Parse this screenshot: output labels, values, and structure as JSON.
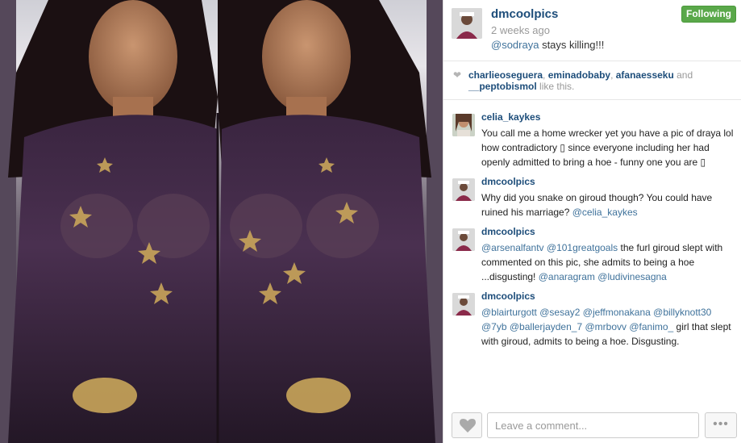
{
  "post": {
    "author": "dmcoolpics",
    "time_ago": "2 weeks ago",
    "caption_mention": "@sodraya",
    "caption_text": " stays killing!!!",
    "follow_label": "Following",
    "photo_icon": "photo-image"
  },
  "likes": {
    "users": [
      "charlieoseguera",
      "eminadobaby",
      "afanaesseku",
      "__peptobismol"
    ],
    "sep1": ", ",
    "sep2": ", ",
    "sep3": " and ",
    "suffix": " like this."
  },
  "comments": [
    {
      "user": "celia_kaykes",
      "segments": [
        {
          "text": "You call me a home wrecker yet you have a pic of draya lol how contradictory ",
          "type": "text"
        },
        {
          "text": "▯",
          "type": "text"
        },
        {
          "text": " since everyone including her had openly admitted to bring a hoe - funny one you are ",
          "type": "text"
        },
        {
          "text": "▯",
          "type": "text"
        }
      ]
    },
    {
      "user": "dmcoolpics",
      "segments": [
        {
          "text": "Why did you snake on giroud though? You could have ruined his marriage? ",
          "type": "text"
        },
        {
          "text": "@celia_kaykes",
          "type": "mention"
        }
      ]
    },
    {
      "user": "dmcoolpics",
      "segments": [
        {
          "text": "@arsenalfantv",
          "type": "mention"
        },
        {
          "text": " ",
          "type": "text"
        },
        {
          "text": "@101greatgoals",
          "type": "mention"
        },
        {
          "text": " the furl giroud slept with commented on this pic, she admits to being a hoe ...disgusting! ",
          "type": "text"
        },
        {
          "text": "@anaragram",
          "type": "mention"
        },
        {
          "text": " ",
          "type": "text"
        },
        {
          "text": "@ludivinesagna",
          "type": "mention"
        }
      ]
    },
    {
      "user": "dmcoolpics",
      "segments": [
        {
          "text": "@blairturgott",
          "type": "mention"
        },
        {
          "text": " ",
          "type": "text"
        },
        {
          "text": "@sesay2",
          "type": "mention"
        },
        {
          "text": " ",
          "type": "text"
        },
        {
          "text": "@jeffmonakana",
          "type": "mention"
        },
        {
          "text": " ",
          "type": "text"
        },
        {
          "text": "@billyknott30",
          "type": "mention"
        },
        {
          "text": " ",
          "type": "text"
        },
        {
          "text": "@7yb",
          "type": "mention"
        },
        {
          "text": " ",
          "type": "text"
        },
        {
          "text": "@ballerjayden_7",
          "type": "mention"
        },
        {
          "text": " ",
          "type": "text"
        },
        {
          "text": "@mrbovv",
          "type": "mention"
        },
        {
          "text": " ",
          "type": "text"
        },
        {
          "text": "@fanimo_",
          "type": "mention"
        },
        {
          "text": " girl that slept with giroud, admits to being a hoe. Disgusting.",
          "type": "text"
        }
      ]
    }
  ],
  "footer": {
    "comment_placeholder": "Leave a comment...",
    "more_label": "•••",
    "like_icon": "heart-icon"
  },
  "colors": {
    "username": "#1d4d7a",
    "mention": "#3f729b",
    "follow_bg": "#5aa84a",
    "muted": "#999999"
  }
}
